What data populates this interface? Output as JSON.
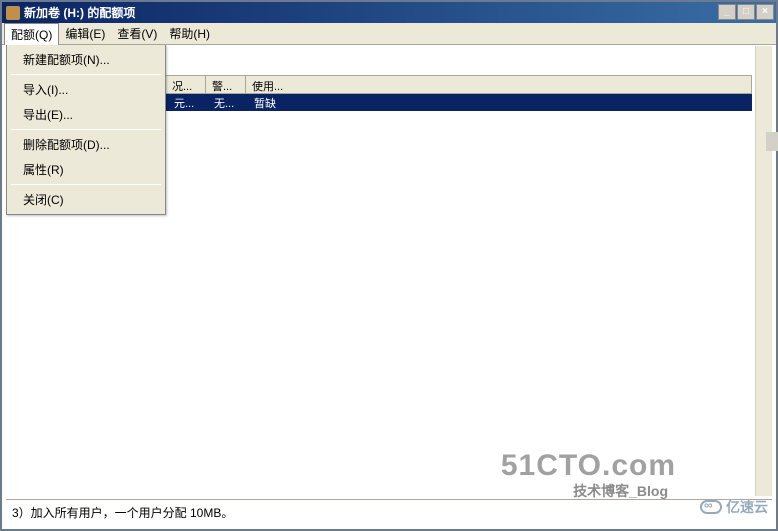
{
  "window": {
    "title": "新加卷 (H:) 的配额项"
  },
  "menubar": {
    "items": [
      "配额(Q)",
      "编辑(E)",
      "查看(V)",
      "帮助(H)"
    ]
  },
  "dropdown": {
    "items": [
      "新建配额项(N)...",
      "导入(I)...",
      "导出(E)...",
      "删除配额项(D)...",
      "属性(R)",
      "关闭(C)"
    ]
  },
  "listheader": {
    "cols": [
      "况...",
      "警...",
      "使用..."
    ]
  },
  "listrow": {
    "cells": [
      "元...",
      "无...",
      "暂缺"
    ]
  },
  "watermarks": {
    "top": "51CTO.com",
    "sub": "技术博客_Blog",
    "right": "亿速云"
  },
  "caption": "3）加入所有用户，一个用户分配 10MB。"
}
